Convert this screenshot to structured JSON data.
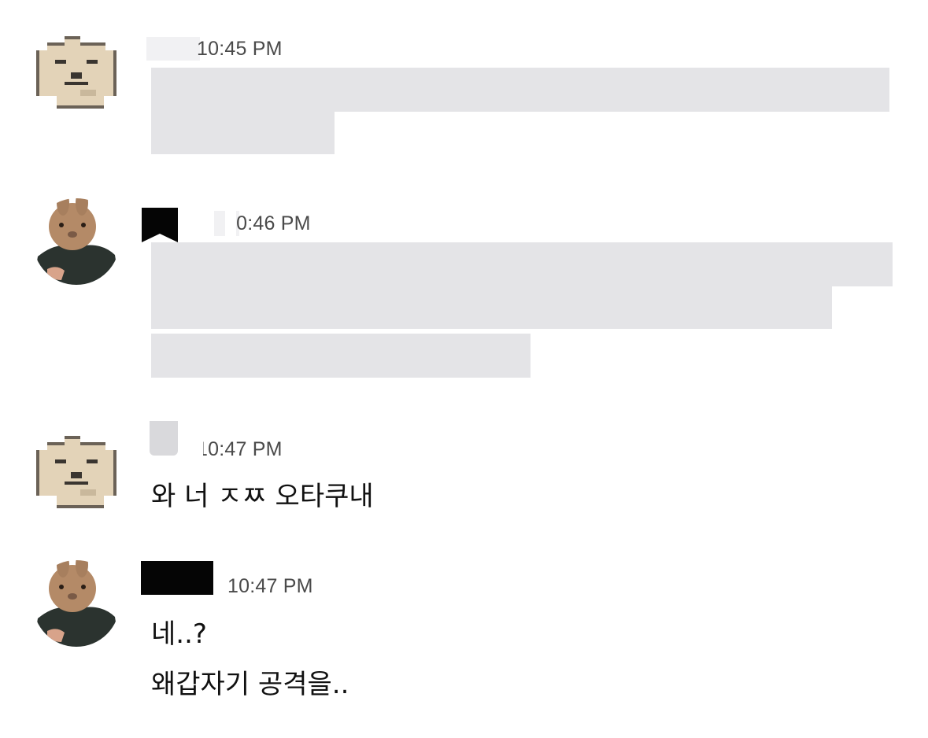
{
  "messages": [
    {
      "avatar_icon": "pixel-rabbit-icon",
      "timestamp": "10:45 PM",
      "lines": []
    },
    {
      "avatar_icon": "rabbit-suit-icon",
      "timestamp": "10:46 PM",
      "lines": []
    },
    {
      "avatar_icon": "pixel-rabbit-icon",
      "timestamp": "10:47 PM",
      "lines": [
        "와 너 ㅈㅉ 오타쿠내"
      ]
    },
    {
      "avatar_icon": "rabbit-suit-icon",
      "timestamp": "10:47 PM",
      "lines": [
        "네..?",
        "왜갑자기 공격을.."
      ]
    }
  ]
}
